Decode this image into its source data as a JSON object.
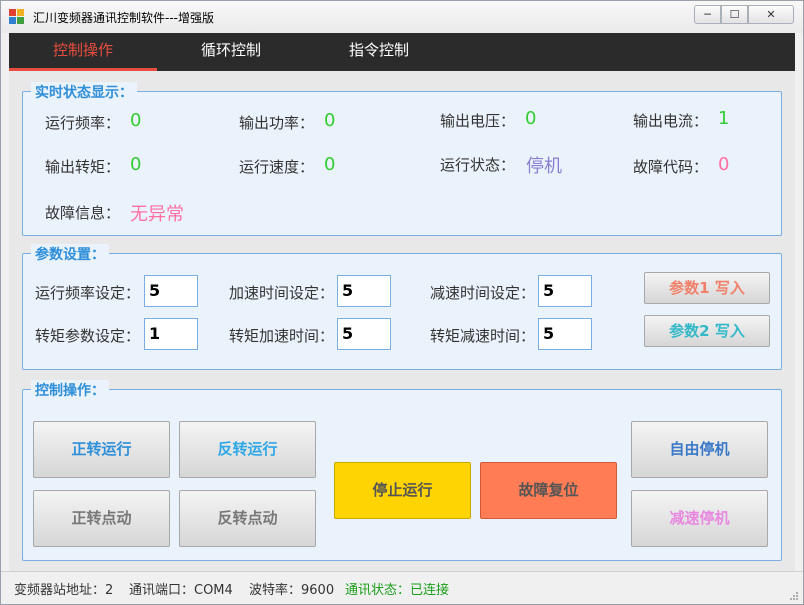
{
  "window": {
    "title": "汇川变频器通讯控制软件---增强版",
    "min_glyph": "─",
    "max_glyph": "☐",
    "close_glyph": "✕"
  },
  "tabs": [
    {
      "label": "控制操作",
      "active": true
    },
    {
      "label": "循环控制",
      "active": false
    },
    {
      "label": "指令控制",
      "active": false
    }
  ],
  "status_panel": {
    "title": "实时状态显示：",
    "run_freq": {
      "label": "运行频率：",
      "value": "0"
    },
    "out_power": {
      "label": "输出功率：",
      "value": "0"
    },
    "out_voltage": {
      "label": "输出电压：",
      "value": "0"
    },
    "out_current": {
      "label": "输出电流：",
      "value": "1"
    },
    "out_torque": {
      "label": "输出转矩：",
      "value": "0"
    },
    "run_speed": {
      "label": "运行速度：",
      "value": "0"
    },
    "run_state": {
      "label": "运行状态：",
      "value": "停机"
    },
    "fault_code": {
      "label": "故障代码：",
      "value": "0"
    },
    "fault_info": {
      "label": "故障信息：",
      "value": "无异常"
    }
  },
  "params_panel": {
    "title": "参数设置：",
    "run_freq_set": {
      "label": "运行频率设定：",
      "value": "5"
    },
    "accel_time_set": {
      "label": "加速时间设定：",
      "value": "5"
    },
    "decel_time_set": {
      "label": "减速时间设定：",
      "value": "5"
    },
    "torque_param_set": {
      "label": "转矩参数设定：",
      "value": "1"
    },
    "torque_accel_time": {
      "label": "转矩加速时间：",
      "value": "5"
    },
    "torque_decel_time": {
      "label": "转矩减速时间：",
      "value": "5"
    },
    "write1_label": "参数1 写入",
    "write2_label": "参数2 写入"
  },
  "control_panel": {
    "title": "控制操作：",
    "forward_run": "正转运行",
    "reverse_run": "反转运行",
    "forward_jog": "正转点动",
    "reverse_jog": "反转点动",
    "stop_run": "停止运行",
    "fault_reset": "故障复位",
    "free_stop": "自由停机",
    "decel_stop": "减速停机"
  },
  "statusbar": {
    "station": "变频器站地址：2",
    "port": "通讯端口：COM4",
    "baud": "波特率：9600",
    "comm_state": "通讯状态：已连接"
  },
  "colors": {
    "accent_tab": "#e84e3f",
    "value_green": "#33cc33",
    "value_purple": "#8a7fd0",
    "value_pink": "#ff6fa3",
    "group_title": "#2f8fd8",
    "stop_button": "#ffd400",
    "reset_button": "#ff7c55"
  }
}
